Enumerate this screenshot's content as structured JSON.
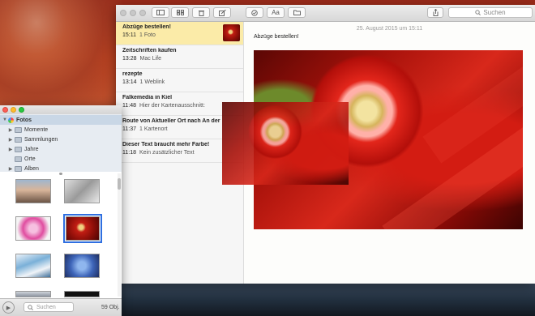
{
  "notes_window": {
    "toolbar": {
      "icons": [
        "sidebar-toggle-icon",
        "attachments-grid-icon",
        "trash-icon",
        "compose-icon",
        "checklist-icon",
        "font-icon",
        "folder-icon",
        "share-icon"
      ],
      "search_placeholder": "Suchen"
    },
    "notes": [
      {
        "title": "Abzüge bestellen!",
        "time": "15:11",
        "detail": "1 Foto",
        "selected": true,
        "thumbnail": true
      },
      {
        "title": "Zeitschriften kaufen",
        "time": "13:28",
        "detail": "Mac Life"
      },
      {
        "title": "rezepte",
        "time": "13:14",
        "detail": "1 Weblink"
      },
      {
        "title": "Falkemedia in Kiel",
        "time": "11:48",
        "detail": "Hier der Kartenausschnitt:"
      },
      {
        "title": "Route von Aktueller Ort nach An der",
        "time": "11:37",
        "detail": "1 Kartenort"
      },
      {
        "title": "Dieser Text braucht mehr Farbe!",
        "time": "11:18",
        "detail": "Kein zusätzlicher Text"
      }
    ],
    "editor": {
      "date": "25. August 2015 um 15:11",
      "body": "Abzüge bestellen!"
    }
  },
  "photos_window": {
    "sidebar": {
      "root": "Fotos",
      "items": [
        "Momente",
        "Sammlungen",
        "Jahre",
        "Orte",
        "Alben"
      ]
    },
    "search_placeholder": "Suchen",
    "count": "59 Obj."
  }
}
